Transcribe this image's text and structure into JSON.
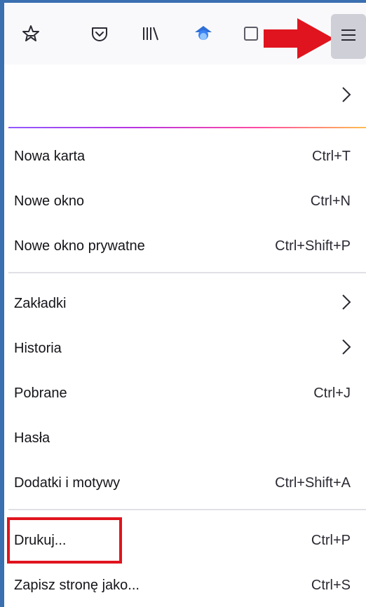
{
  "toolbar": {
    "icons": [
      "bookmark-star-icon",
      "pocket-icon",
      "library-icon",
      "extension-blue-icon",
      "extension-gray-icon"
    ],
    "menu_button_icon": "hamburger-menu-icon"
  },
  "annotations": {
    "arrow_color": "#e0141e",
    "box_color": "#e0141e"
  },
  "menu": {
    "header_chevron_icon": "chevron-right-icon",
    "items": [
      {
        "label": "Nowa karta",
        "shortcut": "Ctrl+T"
      },
      {
        "label": "Nowe okno",
        "shortcut": "Ctrl+N"
      },
      {
        "label": "Nowe okno prywatne",
        "shortcut": "Ctrl+Shift+P"
      },
      {
        "label": "Zakładki",
        "shortcut": ""
      },
      {
        "label": "Historia",
        "shortcut": ""
      },
      {
        "label": "Pobrane",
        "shortcut": "Ctrl+J"
      },
      {
        "label": "Hasła",
        "shortcut": ""
      },
      {
        "label": "Dodatki i motywy",
        "shortcut": "Ctrl+Shift+A"
      },
      {
        "label": "Drukuj...",
        "shortcut": "Ctrl+P"
      },
      {
        "label": "Zapisz stronę jako...",
        "shortcut": "Ctrl+S"
      }
    ]
  }
}
